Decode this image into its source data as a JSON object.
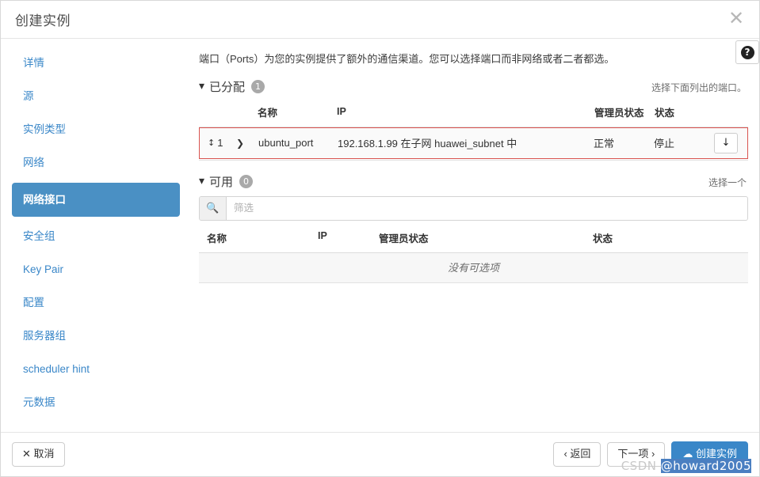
{
  "modal": {
    "title": "创建实例",
    "close_icon": "close-icon"
  },
  "sidebar": {
    "items": [
      {
        "label": "详情"
      },
      {
        "label": "源"
      },
      {
        "label": "实例类型"
      },
      {
        "label": "网络"
      },
      {
        "label": "网络接口"
      },
      {
        "label": "安全组"
      },
      {
        "label": "Key Pair"
      },
      {
        "label": "配置"
      },
      {
        "label": "服务器组"
      },
      {
        "label": "scheduler hint"
      },
      {
        "label": "元数据"
      }
    ],
    "active_index": 4,
    "active_color": "#4a90c4",
    "link_color": "#3a87c8"
  },
  "content": {
    "help_icon": "help-circle-icon",
    "intro": "端口（Ports）为您的实例提供了额外的通信渠道。您可以选择端口而非网络或者二者都选。",
    "allocated": {
      "caret": "▼",
      "title": "已分配",
      "badge": "1",
      "hint": "选择下面列出的端口。",
      "columns": [
        "名称",
        "IP",
        "管理员状态",
        "状态"
      ],
      "rows": [
        {
          "order": "1",
          "sort_icon": "sort-updown-icon",
          "expand_icon": "chevron-right-icon",
          "name": "ubuntu_port",
          "ip": "192.168.1.99 在子网 huawei_subnet 中",
          "admin_state": "正常",
          "state": "停止",
          "action_icon": "arrow-down-icon",
          "highlight_color": "#d9534f"
        }
      ]
    },
    "available": {
      "caret": "▼",
      "title": "可用",
      "badge": "0",
      "hint": "选择一个",
      "filter": {
        "icon": "search-icon",
        "placeholder": "筛选",
        "value": ""
      },
      "columns": [
        "名称",
        "IP",
        "管理员状态",
        "状态"
      ],
      "empty_text": "没有可选项"
    }
  },
  "footer": {
    "cancel": {
      "icon": "x-icon",
      "label": "取消"
    },
    "back": {
      "label": "‹ 返回"
    },
    "next": {
      "label": "下一项 ›"
    },
    "submit": {
      "icon": "cloud-upload-icon",
      "label": "创建实例",
      "color": "#3a87c8"
    }
  },
  "watermark": {
    "prefix": "CSDN ",
    "highlight": "@howard2005"
  }
}
